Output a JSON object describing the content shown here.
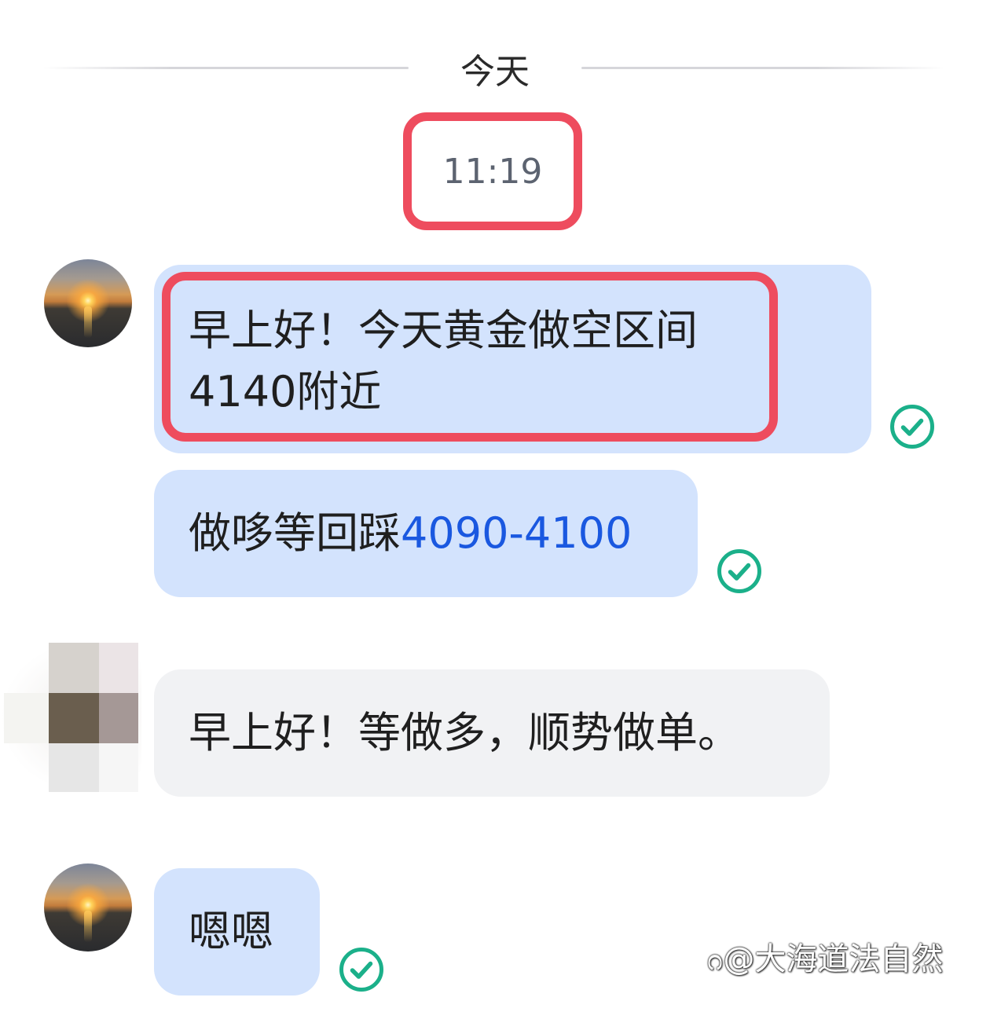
{
  "divider": {
    "date": "今天"
  },
  "timestamp": "11:19",
  "messages": [
    {
      "side": "mine",
      "lines": [
        "早上好！今天黄金做空区间",
        "4140附近"
      ],
      "status_icon": "check-circle-icon"
    },
    {
      "side": "mine",
      "prefix": "做哆等回踩",
      "link": "4090-4100",
      "status_icon": "check-circle-icon"
    },
    {
      "side": "other",
      "text": "早上好！等做多，顺势做单。"
    },
    {
      "side": "mine",
      "text": "嗯嗯",
      "status_icon": "check-circle-icon"
    }
  ],
  "watermark": "ᦅ@大海道法自然",
  "colors": {
    "my_bubble": "#d3e3fd",
    "other_bubble": "#f1f2f4",
    "highlight": "#ee4c5e",
    "link": "#1a58e0",
    "check": "#1bb08a"
  }
}
